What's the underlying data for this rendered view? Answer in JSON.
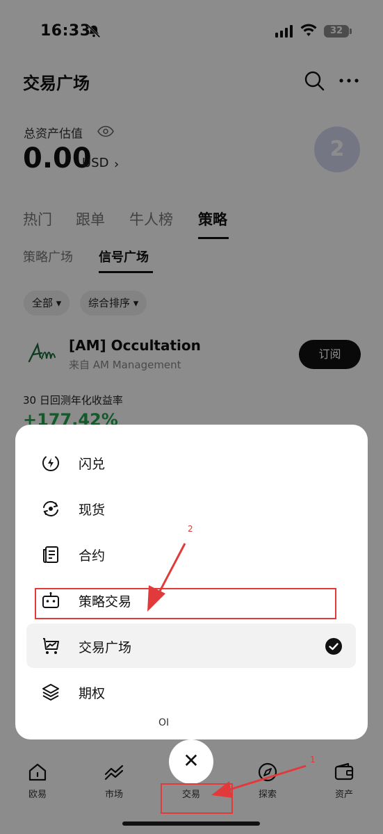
{
  "status_bar": {
    "time": "16:33",
    "battery": "32"
  },
  "header": {
    "title": "交易广场"
  },
  "assets": {
    "label": "总资产估值",
    "value": "0.00",
    "unit": "USD",
    "chevron": "›",
    "avatar": "2"
  },
  "tabs": [
    {
      "label": "热门"
    },
    {
      "label": "跟单"
    },
    {
      "label": "牛人榜"
    },
    {
      "label": "策略",
      "active": true
    }
  ],
  "subtabs": [
    {
      "label": "策略广场"
    },
    {
      "label": "信号广场",
      "active": true
    }
  ],
  "filters": [
    {
      "label": "全部 ▾"
    },
    {
      "label": "综合排序 ▾"
    }
  ],
  "strategy": {
    "name": "[AM] Occultation",
    "source": "来自 AM Management",
    "subscribe": "订阅",
    "metric_label": "30 日回测年化收益率",
    "metric_value": "+177.42%"
  },
  "menu": {
    "items": [
      {
        "label": "闪兑",
        "icon": "flash-icon"
      },
      {
        "label": "现货",
        "icon": "spot-icon"
      },
      {
        "label": "合约",
        "icon": "contract-icon"
      },
      {
        "label": "策略交易",
        "icon": "robot-icon"
      },
      {
        "label": "交易广场",
        "icon": "chart-board-icon",
        "selected": true
      },
      {
        "label": "期权",
        "icon": "layers-icon"
      }
    ],
    "ghost_text": "OI"
  },
  "annotations": {
    "box1_number": "1",
    "box2_number": "2",
    "color": "#e23a3a"
  },
  "bottom_nav": [
    {
      "label": "欧易",
      "icon": "home-icon"
    },
    {
      "label": "市场",
      "icon": "market-icon"
    },
    {
      "label": "交易",
      "icon": "close-icon",
      "active": true
    },
    {
      "label": "探索",
      "icon": "compass-icon"
    },
    {
      "label": "资产",
      "icon": "wallet-icon"
    }
  ],
  "close_symbol": "✕"
}
